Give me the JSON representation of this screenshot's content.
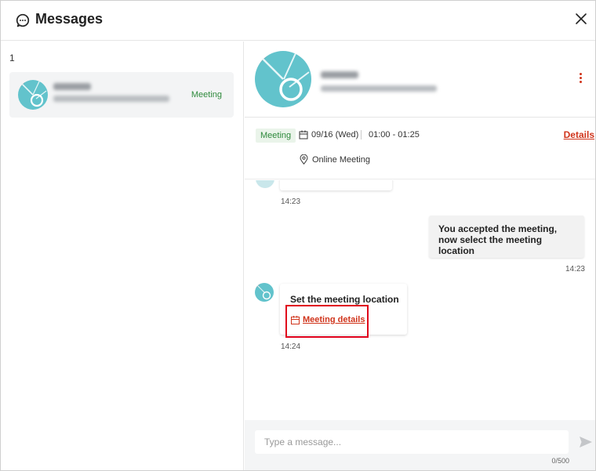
{
  "header": {
    "title": "Messages",
    "icon": "chat-bubble-icon",
    "close_icon": "close-icon"
  },
  "conversation_list": {
    "count": "1",
    "items": [
      {
        "tag": "Meeting",
        "avatar_icon": "avatar-icon"
      }
    ]
  },
  "contact": {
    "avatar_icon": "avatar-icon",
    "menu_icon": "kebab-menu-icon"
  },
  "meeting": {
    "tag": "Meeting",
    "date": "09/16 (Wed)",
    "time": "01:00 - 01:25",
    "details_label": "Details",
    "location": "Online Meeting",
    "calendar_icon": "calendar-icon",
    "pin_icon": "location-pin-icon"
  },
  "messages": [
    {
      "direction": "in",
      "time": "14:23"
    },
    {
      "direction": "out",
      "text": "You accepted the meeting, now select the meeting location",
      "time": "14:23"
    },
    {
      "direction": "in",
      "title": "Set the meeting location",
      "link_label": "Meeting details",
      "time": "14:24"
    }
  ],
  "composer": {
    "placeholder": "Type a message...",
    "counter": "0/500",
    "send_icon": "send-icon"
  },
  "colors": {
    "accent_red": "#d0341b",
    "meeting_green": "#2f8a3d",
    "avatar_teal": "#62c3cc",
    "highlight_red": "#e0001b"
  }
}
